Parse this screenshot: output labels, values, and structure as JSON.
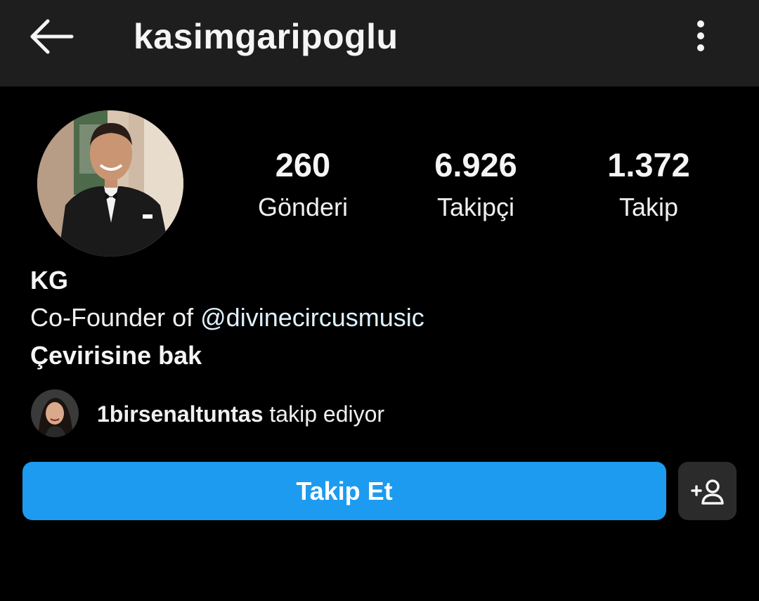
{
  "header": {
    "username": "kasimgaripoglu",
    "back_icon": "arrow-left-icon",
    "menu_icon": "vertical-dots-icon"
  },
  "profile": {
    "stats": [
      {
        "value": "260",
        "label": "Gönderi"
      },
      {
        "value": "6.926",
        "label": "Takipçi"
      },
      {
        "value": "1.372",
        "label": "Takip"
      }
    ],
    "name": "KG",
    "bio_prefix": "Co-Founder of ",
    "bio_mention": "@divinecircusmusic",
    "translate_link": "Çevirisine bak"
  },
  "followed_by": {
    "username": "1birsenaltuntas",
    "text": " takip ediyor"
  },
  "actions": {
    "follow_label": "Takip Et",
    "suggest_icon": "add-person-icon"
  },
  "colors": {
    "background": "#000000",
    "header_bg": "#1e1e1e",
    "follow_button": "#1c9bf0",
    "secondary_button": "#2b2b2b",
    "mention": "#e0f1ff"
  }
}
